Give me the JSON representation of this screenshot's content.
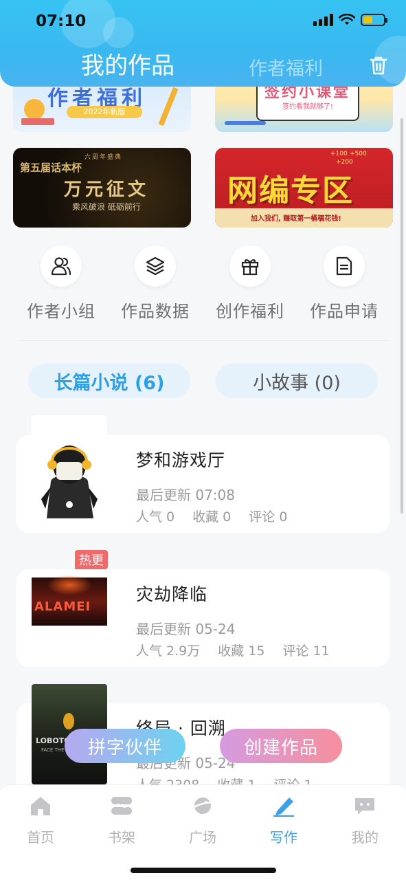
{
  "status_bar": {
    "time": "07:10"
  },
  "header": {
    "tab_active": "我的作品",
    "tab_inactive": "作者福利",
    "trash_icon": "trash-icon"
  },
  "banners": [
    {
      "text": "作者福利",
      "sub": "2022年新版"
    },
    {
      "text": "签约小课堂",
      "sub": "签约看我就够了!"
    },
    {
      "top_text": "六周年盛典",
      "text": "第五届话本杯",
      "big": "万元征文",
      "sub": "乘风破浪 砥砺前行"
    },
    {
      "text": "网编专区",
      "sub": "加入我们, 赚取第一桶稿花钱!",
      "bonus1": "+100",
      "bonus2": "+500",
      "bonus3": "+200"
    }
  ],
  "shortcuts": [
    {
      "label": "作者小组",
      "icon": "users-icon"
    },
    {
      "label": "作品数据",
      "icon": "layers-icon"
    },
    {
      "label": "创作福利",
      "icon": "gift-icon"
    },
    {
      "label": "作品申请",
      "icon": "document-icon"
    }
  ],
  "novel_tabs": [
    {
      "label": "长篇小说 (6)",
      "active": true
    },
    {
      "label": "小故事 (0)",
      "active": false
    }
  ],
  "works": [
    {
      "title": "梦和游戏厅",
      "updated": "最后更新 07:08",
      "popularity": "人气 0",
      "favorites": "收藏 0",
      "comments": "评论 0"
    },
    {
      "title": "灾劫降临",
      "badge": "热更",
      "updated": "最后更新 05-24",
      "popularity": "人气 2.9万",
      "favorites": "收藏 15",
      "comments": "评论 11",
      "cover_text": "ALAMEI"
    },
    {
      "title": "终局 · 回溯",
      "updated": "最后更新 05-24",
      "popularity": "人气 2308",
      "favorites": "收藏 1",
      "comments": "评论 1",
      "cover_text": "LOBOTOMY",
      "cover_sub": "FACE THE FEAR"
    }
  ],
  "floating_buttons": {
    "partner": "拼字伙伴",
    "create": "创建作品"
  },
  "bottom_nav": [
    {
      "label": "首页",
      "icon": "home-icon",
      "active": false
    },
    {
      "label": "书架",
      "icon": "bookshelf-icon",
      "active": false
    },
    {
      "label": "广场",
      "icon": "planet-icon",
      "active": false
    },
    {
      "label": "写作",
      "icon": "pen-icon",
      "active": true
    },
    {
      "label": "我的",
      "icon": "chat-bubble-icon",
      "active": false
    }
  ],
  "colors": {
    "accent": "#3aa3e8",
    "header": "#36c3f2",
    "hot": "#ef6a6a"
  }
}
